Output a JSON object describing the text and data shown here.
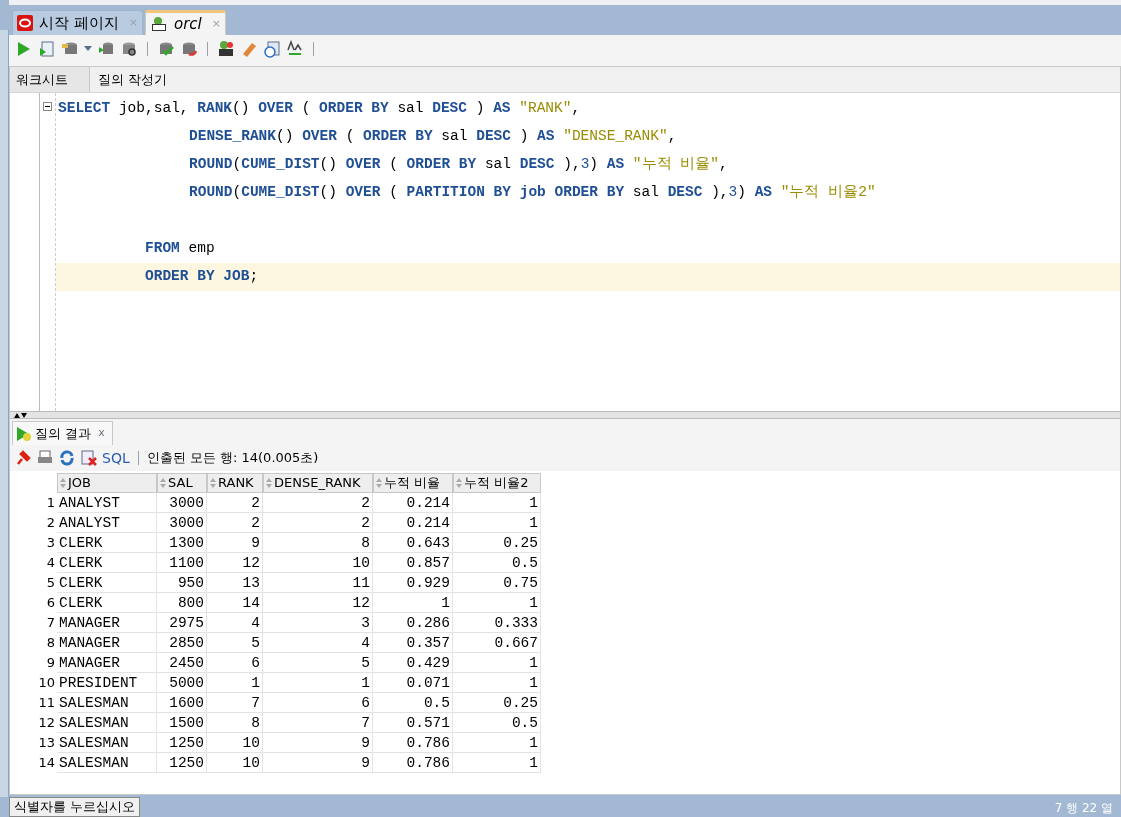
{
  "doc_tabs": [
    {
      "label": "시작 페이지",
      "kind": "start",
      "selected": false,
      "close": "×"
    },
    {
      "label": "orcl",
      "kind": "sql",
      "selected": true,
      "close": "×"
    }
  ],
  "editor_tabs": [
    {
      "label": "워크시트",
      "selected": true
    },
    {
      "label": "질의 작성기",
      "selected": false
    }
  ],
  "code_lines": [
    {
      "kind": "select",
      "current": false,
      "tokens": [
        {
          "kind": "kw",
          "text": "SELECT"
        },
        {
          "kind": "id",
          "text": " job,sal, "
        },
        {
          "kind": "kw",
          "text": "RANK"
        },
        {
          "kind": "id",
          "text": "() "
        },
        {
          "kind": "kw",
          "text": "OVER"
        },
        {
          "kind": "id",
          "text": " ( "
        },
        {
          "kind": "kw",
          "text": "ORDER BY"
        },
        {
          "kind": "id",
          "text": " sal "
        },
        {
          "kind": "kw",
          "text": "DESC"
        },
        {
          "kind": "id",
          "text": " ) "
        },
        {
          "kind": "kw",
          "text": "AS"
        },
        {
          "kind": "str",
          "text": " \"RANK\""
        },
        {
          "kind": "id",
          "text": ","
        }
      ]
    },
    {
      "kind": "continuation",
      "current": false,
      "tokens": [
        {
          "kind": "kw",
          "text": "DENSE_RANK"
        },
        {
          "kind": "id",
          "text": "() "
        },
        {
          "kind": "kw",
          "text": "OVER"
        },
        {
          "kind": "id",
          "text": " ( "
        },
        {
          "kind": "kw",
          "text": "ORDER BY"
        },
        {
          "kind": "id",
          "text": " sal "
        },
        {
          "kind": "kw",
          "text": "DESC"
        },
        {
          "kind": "id",
          "text": " ) "
        },
        {
          "kind": "kw",
          "text": "AS"
        },
        {
          "kind": "str",
          "text": " \"DENSE_RANK\""
        },
        {
          "kind": "id",
          "text": ","
        }
      ]
    },
    {
      "kind": "continuation",
      "current": false,
      "tokens": [
        {
          "kind": "kw",
          "text": "ROUND"
        },
        {
          "kind": "id",
          "text": "("
        },
        {
          "kind": "kw",
          "text": "CUME_DIST"
        },
        {
          "kind": "id",
          "text": "() "
        },
        {
          "kind": "kw",
          "text": "OVER"
        },
        {
          "kind": "id",
          "text": " ( "
        },
        {
          "kind": "kw",
          "text": "ORDER BY"
        },
        {
          "kind": "id",
          "text": " sal "
        },
        {
          "kind": "kw",
          "text": "DESC"
        },
        {
          "kind": "id",
          "text": " ),"
        },
        {
          "kind": "num",
          "text": "3"
        },
        {
          "kind": "id",
          "text": ") "
        },
        {
          "kind": "kw",
          "text": "AS"
        },
        {
          "kind": "str",
          "text": " \"누적 비율\""
        },
        {
          "kind": "id",
          "text": ","
        }
      ]
    },
    {
      "kind": "continuation",
      "current": false,
      "tokens": [
        {
          "kind": "kw",
          "text": "ROUND"
        },
        {
          "kind": "id",
          "text": "("
        },
        {
          "kind": "kw",
          "text": "CUME_DIST"
        },
        {
          "kind": "id",
          "text": "() "
        },
        {
          "kind": "kw",
          "text": "OVER"
        },
        {
          "kind": "id",
          "text": " ( "
        },
        {
          "kind": "kw",
          "text": "PARTITION BY job ORDER BY"
        },
        {
          "kind": "id",
          "text": " sal "
        },
        {
          "kind": "kw",
          "text": "DESC"
        },
        {
          "kind": "id",
          "text": " ),"
        },
        {
          "kind": "num",
          "text": "3"
        },
        {
          "kind": "id",
          "text": ") "
        },
        {
          "kind": "kw",
          "text": "AS"
        },
        {
          "kind": "str",
          "text": " \"누적 비율2\""
        }
      ]
    },
    {
      "kind": "blank",
      "current": false
    },
    {
      "kind": "clause",
      "current": false,
      "tokens": [
        {
          "kind": "kw",
          "text": "FROM"
        },
        {
          "kind": "id",
          "text": " emp"
        }
      ]
    },
    {
      "kind": "clause",
      "current": true,
      "tokens": [
        {
          "kind": "kw",
          "text": "ORDER BY JOB"
        },
        {
          "kind": "id",
          "text": ";"
        }
      ]
    }
  ],
  "results_tab": {
    "label": "질의 결과",
    "close": "x"
  },
  "results_toolbar": {
    "sql_link": "SQL",
    "status": "인출된 모든 행: 14(0.005초)"
  },
  "table": {
    "columns": [
      "JOB",
      "SAL",
      "RANK",
      "DENSE_RANK",
      "누적 비율",
      "누적 비율2"
    ],
    "rows": [
      {
        "num": "1",
        "cells": [
          "ANALYST",
          "3000",
          "2",
          "2",
          "0.214",
          "1"
        ]
      },
      {
        "num": "2",
        "cells": [
          "ANALYST",
          "3000",
          "2",
          "2",
          "0.214",
          "1"
        ]
      },
      {
        "num": "3",
        "cells": [
          "CLERK",
          "1300",
          "9",
          "8",
          "0.643",
          "0.25"
        ]
      },
      {
        "num": "4",
        "cells": [
          "CLERK",
          "1100",
          "12",
          "10",
          "0.857",
          "0.5"
        ]
      },
      {
        "num": "5",
        "cells": [
          "CLERK",
          "950",
          "13",
          "11",
          "0.929",
          "0.75"
        ]
      },
      {
        "num": "6",
        "cells": [
          "CLERK",
          "800",
          "14",
          "12",
          "1",
          "1"
        ]
      },
      {
        "num": "7",
        "cells": [
          "MANAGER",
          "2975",
          "4",
          "3",
          "0.286",
          "0.333"
        ]
      },
      {
        "num": "8",
        "cells": [
          "MANAGER",
          "2850",
          "5",
          "4",
          "0.357",
          "0.667"
        ]
      },
      {
        "num": "9",
        "cells": [
          "MANAGER",
          "2450",
          "6",
          "5",
          "0.429",
          "1"
        ]
      },
      {
        "num": "10",
        "cells": [
          "PRESIDENT",
          "5000",
          "1",
          "1",
          "0.071",
          "1"
        ]
      },
      {
        "num": "11",
        "cells": [
          "SALESMAN",
          "1600",
          "7",
          "6",
          "0.5",
          "0.25"
        ]
      },
      {
        "num": "12",
        "cells": [
          "SALESMAN",
          "1500",
          "8",
          "7",
          "0.571",
          "0.5"
        ]
      },
      {
        "num": "13",
        "cells": [
          "SALESMAN",
          "1250",
          "10",
          "9",
          "0.786",
          "1"
        ]
      },
      {
        "num": "14",
        "cells": [
          "SALESMAN",
          "1250",
          "10",
          "9",
          "0.786",
          "1"
        ]
      }
    ]
  },
  "status_bar": {
    "left": "식별자를 누르십시오",
    "right": "7 행 22 열"
  }
}
